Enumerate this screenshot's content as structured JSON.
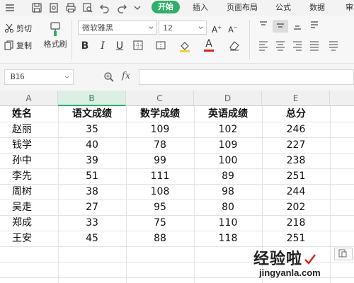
{
  "menubar": {
    "tabs": [
      {
        "label": "开始",
        "active": true
      },
      {
        "label": "插入",
        "active": false
      },
      {
        "label": "页面布局",
        "active": false
      },
      {
        "label": "公式",
        "active": false
      },
      {
        "label": "数据",
        "active": false
      },
      {
        "label": "审",
        "active": false
      }
    ],
    "quick_icons": [
      "save-icon",
      "print-preview-icon",
      "print-icon",
      "find-icon",
      "undo-icon",
      "redo-icon",
      "more-dropdown-icon"
    ],
    "accent_color": "#2faf6a"
  },
  "ribbon": {
    "cut_label": "剪切",
    "format_painter_label": "格式刷",
    "copy_label": "复制",
    "font_name": "微软雅黑",
    "font_size": "12",
    "bold": "B",
    "italic": "I",
    "underline": "U",
    "font_color": "#e02020",
    "fill_color": "#f5d22e"
  },
  "formula_bar": {
    "cell_ref": "B16",
    "fx_label": "fx",
    "value": ""
  },
  "sheet": {
    "selected_column": "B",
    "columns": [
      "A",
      "B",
      "C",
      "D",
      "E"
    ],
    "header": [
      "姓名",
      "语文成绩",
      "数学成绩",
      "英语成绩",
      "总分"
    ],
    "rows": [
      [
        "赵丽",
        "35",
        "109",
        "102",
        "246"
      ],
      [
        "钱学",
        "40",
        "78",
        "109",
        "227"
      ],
      [
        "孙中",
        "39",
        "99",
        "100",
        "238"
      ],
      [
        "李先",
        "51",
        "111",
        "89",
        "251"
      ],
      [
        "周树",
        "38",
        "108",
        "98",
        "244"
      ],
      [
        "吴走",
        "27",
        "95",
        "80",
        "202"
      ],
      [
        "郑成",
        "33",
        "75",
        "110",
        "218"
      ],
      [
        "王安",
        "45",
        "88",
        "118",
        "251"
      ]
    ]
  },
  "watermark": {
    "title": "经验啦",
    "url": "jingyanla.com"
  }
}
